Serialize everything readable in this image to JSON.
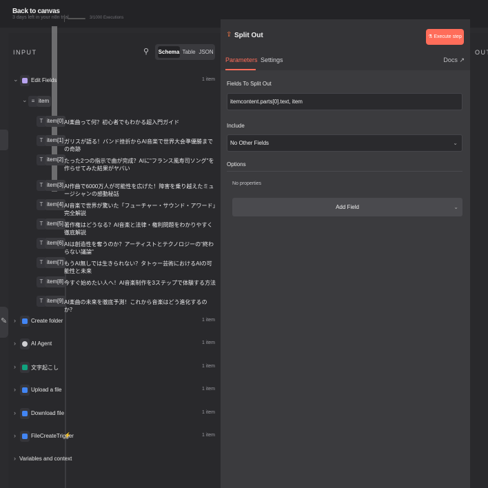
{
  "topbar": {
    "back_label": "Back to canvas",
    "trial_text": "3 days left in your n8n trial",
    "executions_text": "3/1000 Executions"
  },
  "input_panel": {
    "title": "INPUT",
    "view_tabs": [
      "Schema",
      "Table",
      "JSON"
    ],
    "active_view": "Schema",
    "edit_fields": {
      "label": "Edit Fields",
      "count": "1 item",
      "item_key": "item",
      "items": [
        {
          "key": "item[0]",
          "value": "AI楽曲って何？初心者でもわかる超入門ガイド"
        },
        {
          "key": "item[1]",
          "value": "ガリスが語る！バンド挫折からAI音楽で世界大会準優勝までの奇跡"
        },
        {
          "key": "item[2]",
          "value": "たった2つの指示で曲が完成？AIに\"フランス風寿司ソング\"を作らせてみた結果がヤバい"
        },
        {
          "key": "item[3]",
          "value": "AI作曲で6000万人が可能性を広げた！障害を乗り越えたミュージシャンの感動秘話"
        },
        {
          "key": "item[4]",
          "value": "AI音楽で世界が驚いた「フューチャー・サウンド・アワード」完全解説"
        },
        {
          "key": "item[5]",
          "value": "著作権はどうなる？AI音楽と法律・権利問題をわかりやすく徹底解説"
        },
        {
          "key": "item[6]",
          "value": "AIは創造性を奪うのか？アーティストとテクノロジーの\"終わらない議論\""
        },
        {
          "key": "item[7]",
          "value": "もうAI無しでは生きられない？タトゥー芸術におけるAIの可能性と未来"
        },
        {
          "key": "item[8]",
          "value": "今すぐ始めたい人へ！AI音楽制作を3ステップで体験する方法"
        },
        {
          "key": "item[9]",
          "value": "AI楽曲の未来を徹底予測！これから音楽はどう進化するのか？"
        }
      ]
    },
    "nodes": [
      {
        "label": "Create folder",
        "count": "1 item",
        "color": "#4285f4"
      },
      {
        "label": "AI Agent",
        "count": "1 item",
        "color": "#d0d0d4"
      },
      {
        "label": "文字起こし",
        "count": "1 item",
        "color": "#10a37f"
      },
      {
        "label": "Upload a file",
        "count": "1 item",
        "color": "#4285f4"
      },
      {
        "label": "Download file",
        "count": "1 item",
        "color": "#4285f4"
      },
      {
        "label": "FileCreateTrigger",
        "count": "1 item",
        "color": "#4285f4"
      }
    ],
    "variables_label": "Variables and context"
  },
  "ndv": {
    "title": "Split Out",
    "execute_label": "Execute step",
    "tabs": [
      "Parameters",
      "Settings"
    ],
    "docs_label": "Docs",
    "fields_label": "Fields To Split Out",
    "fields_value": "itemcontent.parts[0].text, item",
    "include_label": "Include",
    "include_value": "No Other Fields",
    "options_label": "Options",
    "no_properties": "No properties",
    "add_field_label": "Add Field"
  },
  "output_panel": {
    "title": "OUTPUT"
  },
  "colors": {
    "accent": "#ff6d5a",
    "background": "#2b2b2e",
    "panel": "#29292c"
  }
}
